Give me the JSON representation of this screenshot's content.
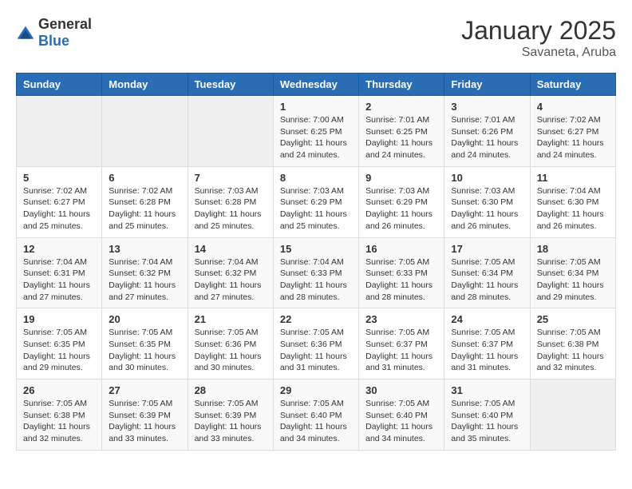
{
  "header": {
    "logo_general": "General",
    "logo_blue": "Blue",
    "month": "January 2025",
    "location": "Savaneta, Aruba"
  },
  "weekdays": [
    "Sunday",
    "Monday",
    "Tuesday",
    "Wednesday",
    "Thursday",
    "Friday",
    "Saturday"
  ],
  "weeks": [
    [
      {
        "day": "",
        "info": ""
      },
      {
        "day": "",
        "info": ""
      },
      {
        "day": "",
        "info": ""
      },
      {
        "day": "1",
        "info": "Sunrise: 7:00 AM\nSunset: 6:25 PM\nDaylight: 11 hours\nand 24 minutes."
      },
      {
        "day": "2",
        "info": "Sunrise: 7:01 AM\nSunset: 6:25 PM\nDaylight: 11 hours\nand 24 minutes."
      },
      {
        "day": "3",
        "info": "Sunrise: 7:01 AM\nSunset: 6:26 PM\nDaylight: 11 hours\nand 24 minutes."
      },
      {
        "day": "4",
        "info": "Sunrise: 7:02 AM\nSunset: 6:27 PM\nDaylight: 11 hours\nand 24 minutes."
      }
    ],
    [
      {
        "day": "5",
        "info": "Sunrise: 7:02 AM\nSunset: 6:27 PM\nDaylight: 11 hours\nand 25 minutes."
      },
      {
        "day": "6",
        "info": "Sunrise: 7:02 AM\nSunset: 6:28 PM\nDaylight: 11 hours\nand 25 minutes."
      },
      {
        "day": "7",
        "info": "Sunrise: 7:03 AM\nSunset: 6:28 PM\nDaylight: 11 hours\nand 25 minutes."
      },
      {
        "day": "8",
        "info": "Sunrise: 7:03 AM\nSunset: 6:29 PM\nDaylight: 11 hours\nand 25 minutes."
      },
      {
        "day": "9",
        "info": "Sunrise: 7:03 AM\nSunset: 6:29 PM\nDaylight: 11 hours\nand 26 minutes."
      },
      {
        "day": "10",
        "info": "Sunrise: 7:03 AM\nSunset: 6:30 PM\nDaylight: 11 hours\nand 26 minutes."
      },
      {
        "day": "11",
        "info": "Sunrise: 7:04 AM\nSunset: 6:30 PM\nDaylight: 11 hours\nand 26 minutes."
      }
    ],
    [
      {
        "day": "12",
        "info": "Sunrise: 7:04 AM\nSunset: 6:31 PM\nDaylight: 11 hours\nand 27 minutes."
      },
      {
        "day": "13",
        "info": "Sunrise: 7:04 AM\nSunset: 6:32 PM\nDaylight: 11 hours\nand 27 minutes."
      },
      {
        "day": "14",
        "info": "Sunrise: 7:04 AM\nSunset: 6:32 PM\nDaylight: 11 hours\nand 27 minutes."
      },
      {
        "day": "15",
        "info": "Sunrise: 7:04 AM\nSunset: 6:33 PM\nDaylight: 11 hours\nand 28 minutes."
      },
      {
        "day": "16",
        "info": "Sunrise: 7:05 AM\nSunset: 6:33 PM\nDaylight: 11 hours\nand 28 minutes."
      },
      {
        "day": "17",
        "info": "Sunrise: 7:05 AM\nSunset: 6:34 PM\nDaylight: 11 hours\nand 28 minutes."
      },
      {
        "day": "18",
        "info": "Sunrise: 7:05 AM\nSunset: 6:34 PM\nDaylight: 11 hours\nand 29 minutes."
      }
    ],
    [
      {
        "day": "19",
        "info": "Sunrise: 7:05 AM\nSunset: 6:35 PM\nDaylight: 11 hours\nand 29 minutes."
      },
      {
        "day": "20",
        "info": "Sunrise: 7:05 AM\nSunset: 6:35 PM\nDaylight: 11 hours\nand 30 minutes."
      },
      {
        "day": "21",
        "info": "Sunrise: 7:05 AM\nSunset: 6:36 PM\nDaylight: 11 hours\nand 30 minutes."
      },
      {
        "day": "22",
        "info": "Sunrise: 7:05 AM\nSunset: 6:36 PM\nDaylight: 11 hours\nand 31 minutes."
      },
      {
        "day": "23",
        "info": "Sunrise: 7:05 AM\nSunset: 6:37 PM\nDaylight: 11 hours\nand 31 minutes."
      },
      {
        "day": "24",
        "info": "Sunrise: 7:05 AM\nSunset: 6:37 PM\nDaylight: 11 hours\nand 31 minutes."
      },
      {
        "day": "25",
        "info": "Sunrise: 7:05 AM\nSunset: 6:38 PM\nDaylight: 11 hours\nand 32 minutes."
      }
    ],
    [
      {
        "day": "26",
        "info": "Sunrise: 7:05 AM\nSunset: 6:38 PM\nDaylight: 11 hours\nand 32 minutes."
      },
      {
        "day": "27",
        "info": "Sunrise: 7:05 AM\nSunset: 6:39 PM\nDaylight: 11 hours\nand 33 minutes."
      },
      {
        "day": "28",
        "info": "Sunrise: 7:05 AM\nSunset: 6:39 PM\nDaylight: 11 hours\nand 33 minutes."
      },
      {
        "day": "29",
        "info": "Sunrise: 7:05 AM\nSunset: 6:40 PM\nDaylight: 11 hours\nand 34 minutes."
      },
      {
        "day": "30",
        "info": "Sunrise: 7:05 AM\nSunset: 6:40 PM\nDaylight: 11 hours\nand 34 minutes."
      },
      {
        "day": "31",
        "info": "Sunrise: 7:05 AM\nSunset: 6:40 PM\nDaylight: 11 hours\nand 35 minutes."
      },
      {
        "day": "",
        "info": ""
      }
    ]
  ]
}
